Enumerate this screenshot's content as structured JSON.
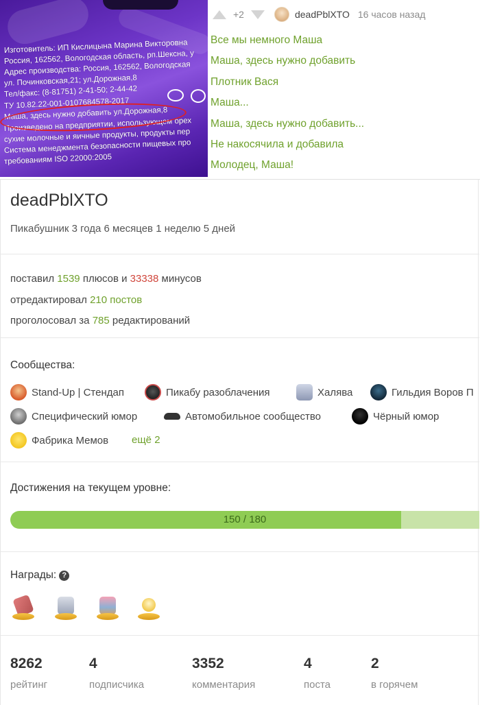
{
  "comment_header": {
    "rating": "+2",
    "author": "deadPblXTO",
    "time": "16 часов назад"
  },
  "photo_text": [
    "Изготовитель: ИП Кислицына Марина Викторовна",
    "Россия, 162562, Вологодская область, рп.Шексна, у",
    "Адрес производства: Россия, 162562, Вологодская",
    "ул. Починковская,21;  ул.Дорожная,8",
    "Тел/факс: (8-81751) 2-41-50; 2-44-42",
    "ТУ 10.82.22-001-0107684578-2017",
    "Маша, здесь нужно добавить ул.Дорожная,8",
    "Произведено на предприятии, использующем орех",
    "сухие молочные и яичные продукты, продукты пер",
    "Система менеджмента безопасности пищевых про",
    "требованиям ISO 22000:2005"
  ],
  "comment_lines": [
    "Все мы немного Маша",
    "Маша, здесь нужно добавить",
    "Плотник Вася",
    "Маша...",
    "Маша, здесь нужно добавить...",
    "Не накосячила и добавила",
    "Молодец, Маша!"
  ],
  "profile": {
    "username": "deadPblXTO",
    "since": "Пикабушник 3 года 6 месяцев 1 неделю 5 дней"
  },
  "stats_text": {
    "line1_a": "поставил ",
    "plus_count": "1539",
    "line1_b": " плюсов и ",
    "minus_count": "33338",
    "line1_c": " минусов",
    "line2_a": "отредактировал ",
    "edited_posts": "210 постов",
    "line3_a": "проголосовал за ",
    "voted_count": "785",
    "line3_b": " редактирований"
  },
  "communities": {
    "title": "Сообщества:",
    "items": [
      {
        "name": "Stand-Up | Стендап",
        "icon": "standup-icon"
      },
      {
        "name": "Пикабу разоблачения",
        "icon": "exposure-icon"
      },
      {
        "name": "Халява",
        "icon": "freebie-icon"
      },
      {
        "name": "Гильдия Воров П",
        "icon": "thieves-guild-icon"
      },
      {
        "name": "Специфический юмор",
        "icon": "specific-humor-icon"
      },
      {
        "name": "Автомобильное сообщество",
        "icon": "car-community-icon"
      },
      {
        "name": "Чёрный юмор",
        "icon": "black-humor-icon"
      },
      {
        "name": "Фабрика Мемов",
        "icon": "meme-factory-icon"
      }
    ],
    "more": "ещё 2"
  },
  "achievements": {
    "title": "Достижения на текущем уровне:",
    "progress_text": "150 / 180",
    "current": 150,
    "max": 180
  },
  "awards": {
    "title": "Награды:",
    "items": [
      "award-1-icon",
      "award-2-icon",
      "award-3-icon",
      "award-4-icon"
    ]
  },
  "bottom_stats": [
    {
      "value": "8262",
      "label": "рейтинг"
    },
    {
      "value": "4",
      "label": "подписчика"
    },
    {
      "value": "3352",
      "label": "комментария"
    },
    {
      "value": "4",
      "label": "поста"
    },
    {
      "value": "2",
      "label": "в горячем"
    }
  ],
  "colors": {
    "accent_green": "#6fa12c",
    "minus_red": "#d0453b",
    "progress_fill": "#8fcc54",
    "progress_bg": "#c8e3a8"
  }
}
